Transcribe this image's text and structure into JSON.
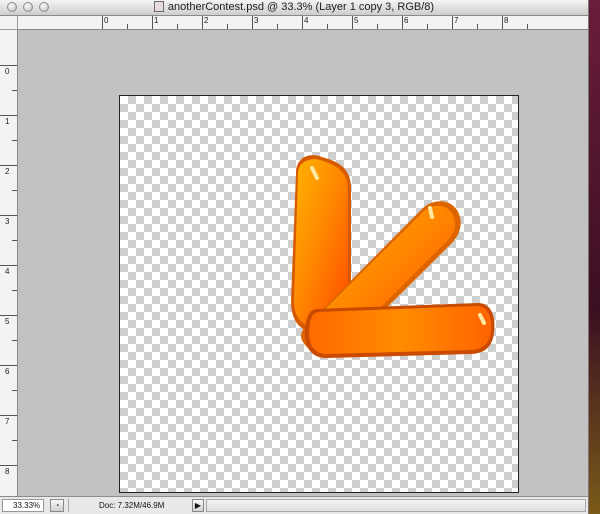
{
  "window": {
    "title": "anotherContest.psd @ 33.3% (Layer 1 copy 3, RGB/8)",
    "controls": [
      "close-icon",
      "minimize-icon",
      "zoom-icon"
    ]
  },
  "rulers": {
    "top_labels": [
      "0",
      "1",
      "2",
      "3",
      "4",
      "5",
      "6",
      "7",
      "8"
    ],
    "left_labels": [
      "0",
      "1",
      "2",
      "3",
      "4",
      "5",
      "6",
      "7",
      "8"
    ],
    "units": ""
  },
  "statusbar": {
    "zoom": "33.33%",
    "doc_info": "Doc: 7.32M/46.9M",
    "arrow": "▶"
  },
  "colors": {
    "canvas_bg": "#c2c2c2",
    "shape_orange": "#ff7a00"
  }
}
